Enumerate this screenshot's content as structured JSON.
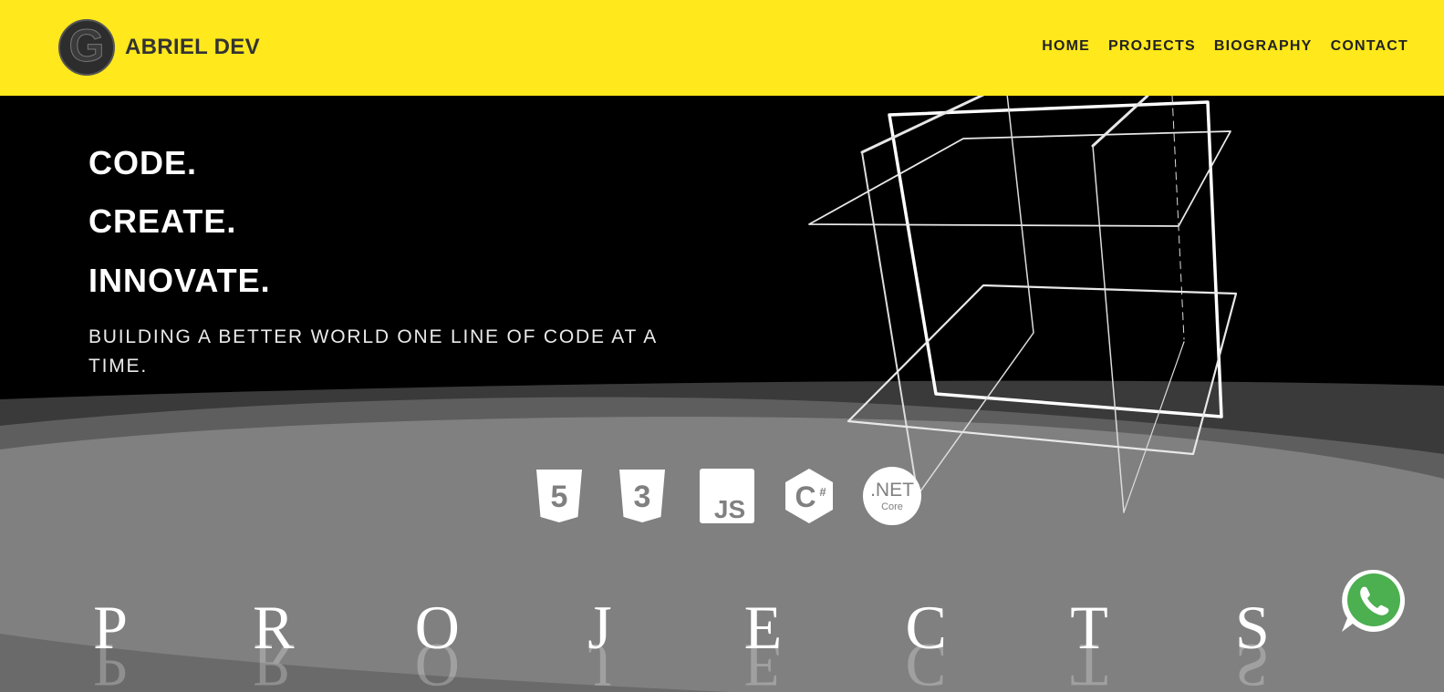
{
  "header": {
    "brand_letter": "G",
    "brand_text": "ABRIEL DEV",
    "nav": [
      {
        "label": "HOME"
      },
      {
        "label": "PROJECTS"
      },
      {
        "label": "BIOGRAPHY"
      },
      {
        "label": "CONTACT"
      }
    ]
  },
  "hero": {
    "lines": [
      "CODE.",
      "CREATE.",
      "INNOVATE."
    ],
    "subtitle": "BUILDING A BETTER WORLD ONE LINE OF CODE AT A TIME."
  },
  "tech_icons": [
    {
      "name": "html5-icon",
      "label": "5"
    },
    {
      "name": "css3-icon",
      "label": "3"
    },
    {
      "name": "javascript-icon",
      "label": "JS"
    },
    {
      "name": "csharp-icon",
      "label": "C#"
    },
    {
      "name": "dotnet-core-icon",
      "label_main": ".NET",
      "label_sub": "Core"
    }
  ],
  "projects_section": {
    "letters": [
      "P",
      "R",
      "O",
      "J",
      "E",
      "C",
      "T",
      "S"
    ]
  },
  "colors": {
    "brand_yellow": "#ffe81c",
    "hero_bg": "#000000",
    "wave_dark": "#3a3a3a",
    "wave_mid": "#5e5e5e",
    "wave_light": "#808080",
    "whatsapp_green": "#4caf50"
  },
  "icons": {
    "whatsapp": "whatsapp-icon",
    "logo": "logo-g-icon"
  }
}
